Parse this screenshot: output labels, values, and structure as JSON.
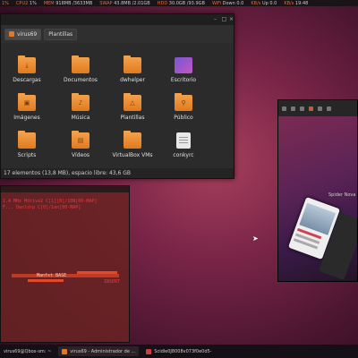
{
  "topbar": {
    "items": [
      {
        "label": "1%",
        "value": ""
      },
      {
        "label": "CPU2",
        "value": "1%"
      },
      {
        "label": "MEM",
        "value": "918MB /3633MB"
      },
      {
        "label": "SWAP",
        "value": "43.8MB /2.01GB"
      },
      {
        "label": "HDD",
        "value": "30.0GB /93.9GB"
      },
      {
        "label": "WiFi",
        "value": "Down 0.0"
      },
      {
        "label": "KB/s",
        "value": "Up 0.0"
      },
      {
        "label": "KB/s",
        "value": "19:48"
      }
    ]
  },
  "file_manager": {
    "path": [
      "virus69",
      "Plantillas"
    ],
    "items": [
      {
        "name": "Descargas",
        "icon": "download-folder-icon",
        "glyph": "⤓",
        "type": "folder"
      },
      {
        "name": "Documentos",
        "icon": "folder-icon",
        "glyph": "",
        "type": "folder"
      },
      {
        "name": "dwhelper",
        "icon": "folder-icon",
        "glyph": "",
        "type": "folder"
      },
      {
        "name": "Escritorio",
        "icon": "desktop-icon",
        "glyph": "",
        "type": "pic"
      },
      {
        "name": "Imágenes",
        "icon": "pictures-folder-icon",
        "glyph": "▣",
        "type": "folder"
      },
      {
        "name": "Música",
        "icon": "music-folder-icon",
        "glyph": "♪",
        "type": "folder"
      },
      {
        "name": "Plantillas",
        "icon": "templates-folder-icon",
        "glyph": "△",
        "type": "folder"
      },
      {
        "name": "Público",
        "icon": "public-folder-icon",
        "glyph": "⚲",
        "type": "folder"
      },
      {
        "name": "Scripts",
        "icon": "folder-icon",
        "glyph": "",
        "type": "folder"
      },
      {
        "name": "Vídeos",
        "icon": "video-folder-icon",
        "glyph": "▤",
        "type": "folder"
      },
      {
        "name": "VirtualBox VMs",
        "icon": "folder-icon",
        "glyph": "",
        "type": "folder"
      },
      {
        "name": "conkyrc",
        "icon": "text-file-icon",
        "glyph": "",
        "type": "doc"
      }
    ],
    "status": "17 elementos (13,8 MB), espacio libre: 43,6 GB"
  },
  "terminal": {
    "lines": [
      "1.4 MHz   Mdrive2 C[1][0]/1EN[00-MAP]",
      "F...   Dwnldrp C[0]/1en[00-MAP]",
      "   Manfst  BASE",
      "INSERT"
    ]
  },
  "app_window": {
    "title": "Spider Nova"
  },
  "taskbar": {
    "tasks": [
      {
        "label": "virus69@Qbox-sm: ~",
        "active": false,
        "icon": "terminal-icon"
      },
      {
        "label": "virus69 - Administrador de ...",
        "active": true,
        "icon": "folder-icon"
      },
      {
        "label": "Scidle0J8008v073f0e0d5-",
        "active": false,
        "icon": "app-icon"
      }
    ]
  }
}
